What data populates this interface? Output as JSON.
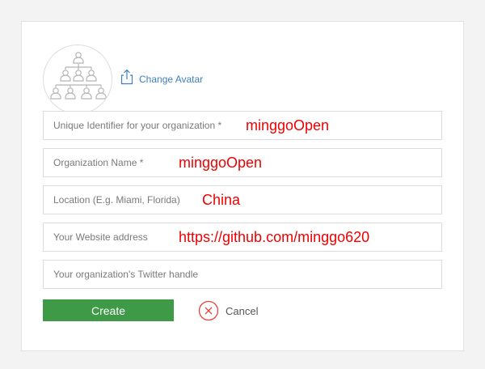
{
  "avatar": {
    "icon": "organization-hierarchy-icon"
  },
  "change_avatar": {
    "label": "Change Avatar",
    "icon": "upload-icon",
    "color": "#3f7fbf"
  },
  "fields": [
    {
      "placeholder": "Unique Identifier for your organization *",
      "value": "minggoOpen"
    },
    {
      "placeholder": "Organization Name *",
      "value": "minggoOpen"
    },
    {
      "placeholder": "Location (E.g. Miami, Florida)",
      "value": "China"
    },
    {
      "placeholder": "Your Website address",
      "value": "https://github.com/minggo620"
    },
    {
      "placeholder": "Your organization's Twitter handle",
      "value": ""
    }
  ],
  "actions": {
    "create_label": "Create",
    "cancel_label": "Cancel",
    "create_color": "#3e9a46",
    "cancel_icon_color": "#e0453a"
  },
  "colors": {
    "annotation_text": "#ee0000"
  }
}
